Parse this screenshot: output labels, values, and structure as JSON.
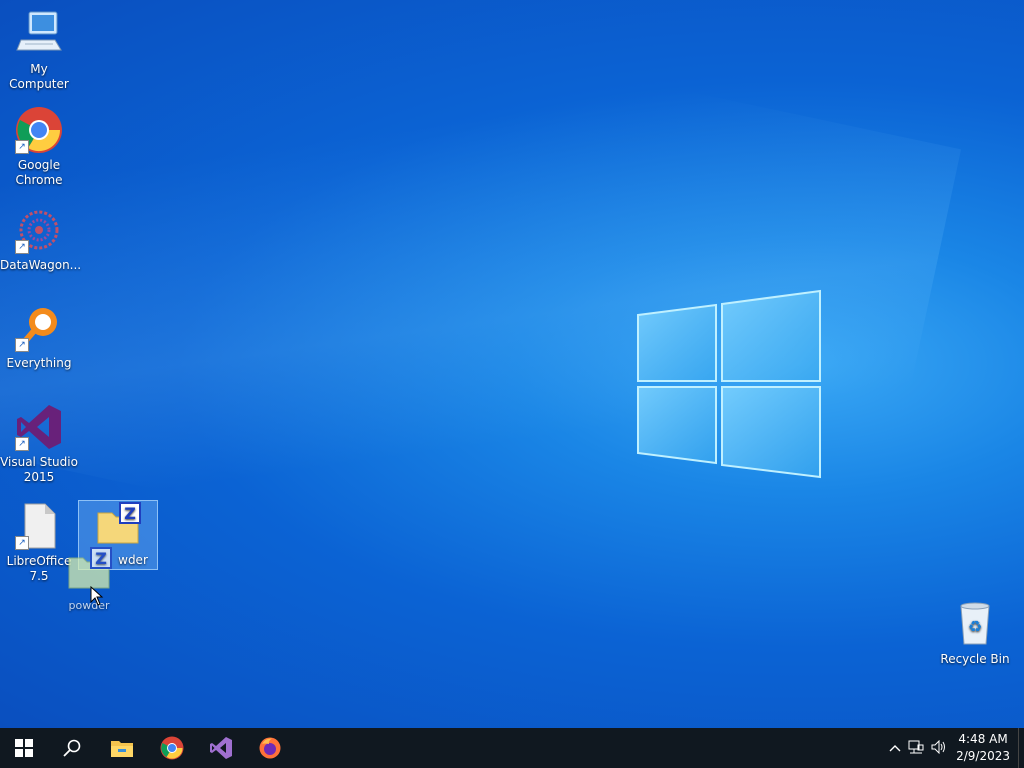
{
  "desktop": {
    "icons": [
      {
        "label": "My Computer",
        "icon": "computer-icon"
      },
      {
        "label": "Google Chrome",
        "icon": "chrome-icon"
      },
      {
        "label": "DataWagon...",
        "icon": "datawagon-icon"
      },
      {
        "label": "Everything",
        "icon": "everything-search-icon"
      },
      {
        "label": "Visual Studio 2015",
        "icon": "visual-studio-icon"
      },
      {
        "label": "LibreOffice 7.5",
        "icon": "libreoffice-icon"
      },
      {
        "label": "powder",
        "icon": "zip-folder-icon"
      },
      {
        "label": "Recycle Bin",
        "icon": "recycle-bin-icon"
      }
    ],
    "drag_ghost_label": "powder",
    "selected_label_visible": "wder"
  },
  "taskbar": {
    "start_icon": "windows-start-icon",
    "search_icon": "search-icon",
    "pinned": [
      "file-explorer-icon",
      "chrome-icon",
      "visual-studio-icon",
      "firefox-icon"
    ],
    "tray_icons": [
      "chevron-up-icon",
      "network-icon",
      "volume-icon"
    ],
    "time": "4:48 AM",
    "date": "2/9/2023"
  },
  "colors": {
    "desktop_blue": "#0b63d4",
    "taskbar": "#101820",
    "accent": "#1a86e6"
  }
}
